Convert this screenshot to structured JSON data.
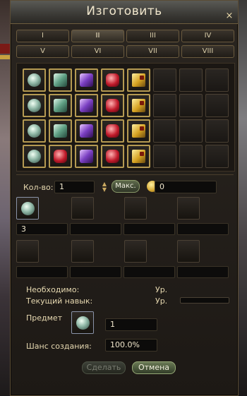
{
  "window": {
    "title": "Изготовить",
    "close_glyph": "×"
  },
  "tabs": [
    "I",
    "II",
    "III",
    "IV",
    "V",
    "VI",
    "VII",
    "VIII"
  ],
  "active_tab": "II",
  "recipe_grid": [
    [
      "pearl",
      "jade",
      "amethyst",
      "ruby",
      "scroll",
      "",
      "",
      ""
    ],
    [
      "pearl",
      "jade",
      "amethyst",
      "ruby",
      "scroll",
      "",
      "",
      ""
    ],
    [
      "pearl",
      "jade",
      "amethyst",
      "ruby",
      "scroll",
      "",
      "",
      ""
    ],
    [
      "pearl",
      "ruby",
      "amethyst",
      "ruby",
      "scroll",
      "",
      "",
      ""
    ]
  ],
  "quantity": {
    "label": "Кол-во:",
    "value": "1",
    "max_label": "Макс.",
    "adena_value": "0"
  },
  "materials": {
    "row1": [
      {
        "icon": "pearl-icon",
        "count": "3"
      },
      {
        "icon": "",
        "count": ""
      },
      {
        "icon": "",
        "count": ""
      },
      {
        "icon": "",
        "count": ""
      }
    ],
    "row2": [
      {
        "icon": "",
        "count": ""
      },
      {
        "icon": "",
        "count": ""
      },
      {
        "icon": "",
        "count": ""
      },
      {
        "icon": "",
        "count": ""
      }
    ]
  },
  "info": {
    "required_label": "Необходимо:",
    "level_label": "Ур.",
    "current_skill_label": "Текущий навык:",
    "level_label2": "Ур.",
    "item_label": "Предмет",
    "item_count": "1",
    "success_label": "Шанс создания:",
    "success_value": "100.0%"
  },
  "buttons": {
    "create": "Сделать",
    "cancel": "Отмена"
  }
}
